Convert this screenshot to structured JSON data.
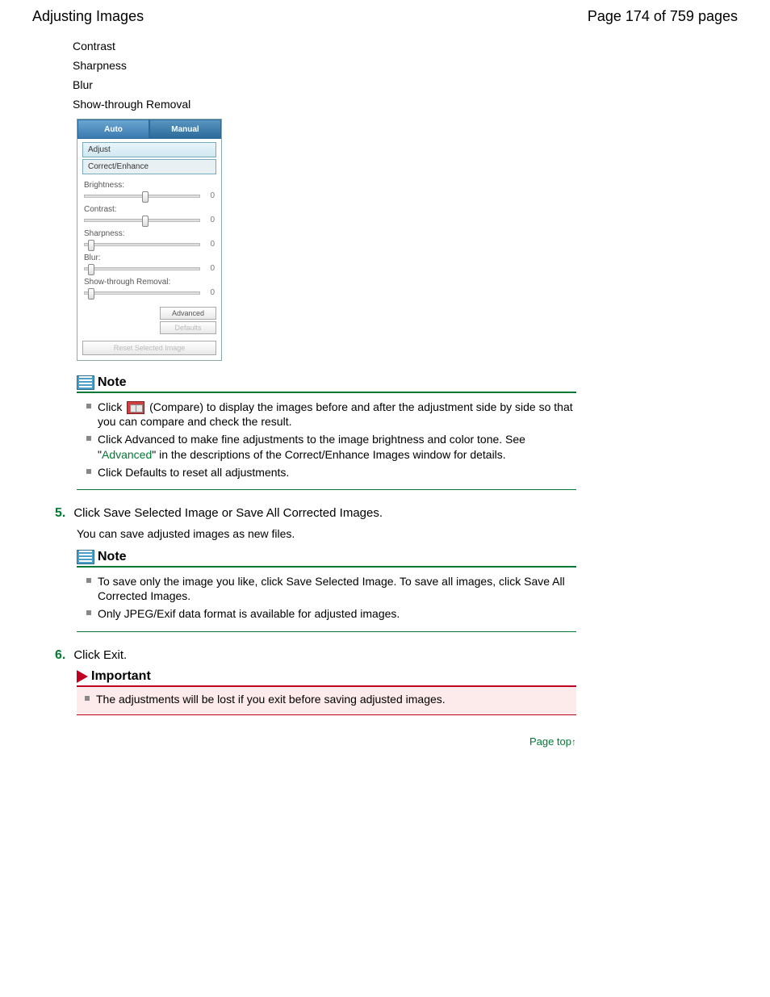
{
  "header": {
    "title": "Adjusting Images",
    "page_indicator": "Page 174 of 759 pages"
  },
  "adjustment_list": [
    "Contrast",
    "Sharpness",
    "Blur",
    "Show-through Removal"
  ],
  "panel": {
    "tabs": {
      "auto": "Auto",
      "manual": "Manual"
    },
    "subtabs": {
      "adjust": "Adjust",
      "correct": "Correct/Enhance"
    },
    "sliders": [
      {
        "label": "Brightness:",
        "value": "0",
        "pos": 50
      },
      {
        "label": "Contrast:",
        "value": "0",
        "pos": 50
      },
      {
        "label": "Sharpness:",
        "value": "0",
        "pos": 3
      },
      {
        "label": "Blur:",
        "value": "0",
        "pos": 3
      },
      {
        "label": "Show-through Removal:",
        "value": "0",
        "pos": 3
      }
    ],
    "buttons": {
      "advanced": "Advanced",
      "defaults": "Defaults",
      "reset": "Reset Selected Image"
    }
  },
  "notes1": {
    "title": "Note",
    "items": {
      "a_pre": "Click ",
      "a_post": " (Compare) to display the images before and after the adjustment side by side so that you can compare and check the result.",
      "b_pre": "Click Advanced to make fine adjustments to the image brightness and color tone. See \"",
      "b_link": "Advanced",
      "b_post": "\" in the descriptions of the Correct/Enhance Images window for details.",
      "c": "Click Defaults to reset all adjustments."
    }
  },
  "step5": {
    "num": "5.",
    "text": "Click Save Selected Image or Save All Corrected Images.",
    "sub": "You can save adjusted images as new files."
  },
  "notes2": {
    "title": "Note",
    "items": {
      "a": "To save only the image you like, click Save Selected Image. To save all images, click Save All Corrected Images.",
      "b": "Only JPEG/Exif data format is available for adjusted images."
    }
  },
  "step6": {
    "num": "6.",
    "text": "Click Exit."
  },
  "important": {
    "title": "Important",
    "text": "The adjustments will be lost if you exit before saving adjusted images."
  },
  "page_top": "Page top"
}
